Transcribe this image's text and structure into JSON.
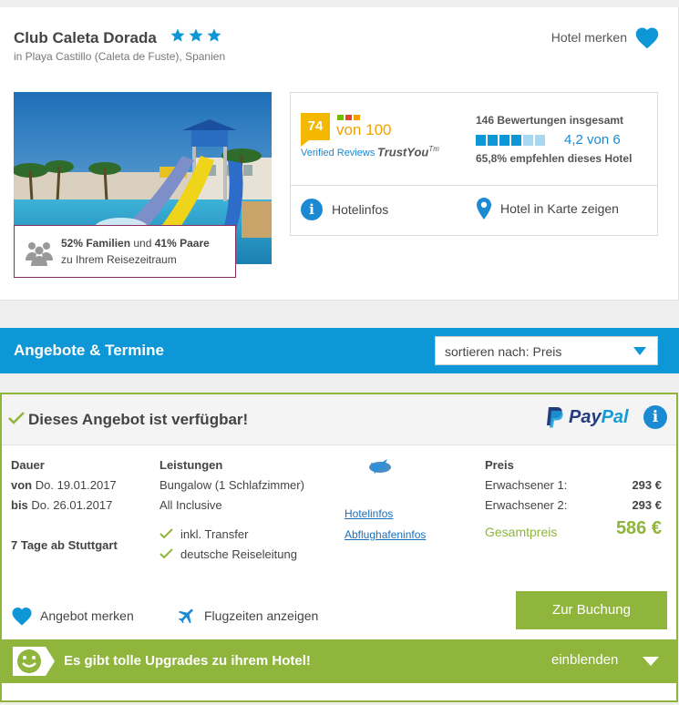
{
  "hotel": {
    "name": "Club Caleta Dorada",
    "stars": 3,
    "location": "in Playa Castillo (Caleta de Fuste), Spanien",
    "save_label": "Hotel merken",
    "family_stats": {
      "families": "52% Familien",
      "connector": " und ",
      "couples": "41% Paare",
      "period": "zu Ihrem Reisezeitraum"
    }
  },
  "rating": {
    "score": "74",
    "of": "von 100",
    "verified": "Verified Reviews",
    "provider": "TrustYou",
    "provider_tm": "Tm",
    "reviews_total": "146 Bewertungen insgesamt",
    "filled_squares": 4,
    "total_squares": 6,
    "value": "4,2 von 6",
    "recommend": "65,8% empfehlen dieses Hotel",
    "hotelinfo_label": "Hotelinfos",
    "map_label": "Hotel in Karte zeigen"
  },
  "offers_bar": {
    "title": "Angebote & Termine",
    "sort_label": "sortieren nach: Preis"
  },
  "offer": {
    "availability": "Dieses Angebot ist verfügbar!",
    "paypal_pay": "Pay",
    "paypal_pal": "Pal",
    "duration": {
      "heading": "Dauer",
      "from_label": "von",
      "from_date": "Do. 19.01.2017",
      "to_label": "bis",
      "to_date": "Do. 26.01.2017",
      "summary": "7 Tage ab Stuttgart"
    },
    "services": {
      "heading": "Leistungen",
      "room": "Bungalow (1 Schlafzimmer)",
      "board": "All Inclusive",
      "extras": [
        "inkl. Transfer",
        "deutsche Reiseleitung"
      ]
    },
    "links": {
      "hotelinfo": "Hotelinfos",
      "airport": "Abflughafeninfos"
    },
    "price": {
      "heading": "Preis",
      "adult1_label": "Erwachsener 1:",
      "adult1_value": "293 €",
      "adult2_label": "Erwachsener 2:",
      "adult2_value": "293 €",
      "total_label": "Gesamtpreis",
      "total_value": "586 €"
    },
    "save_label": "Angebot merken",
    "flight_times_label": "Flugzeiten anzeigen",
    "book_label": "Zur Buchung",
    "upgrade_text": "Es gibt tolle Upgrades zu ihrem Hotel!",
    "upgrade_toggle": "einblenden"
  },
  "colors": {
    "accent_blue": "#0d97d6",
    "accent_green": "#8fb53c",
    "score_yellow": "#f5b800",
    "family_border": "#8d2d5e"
  }
}
